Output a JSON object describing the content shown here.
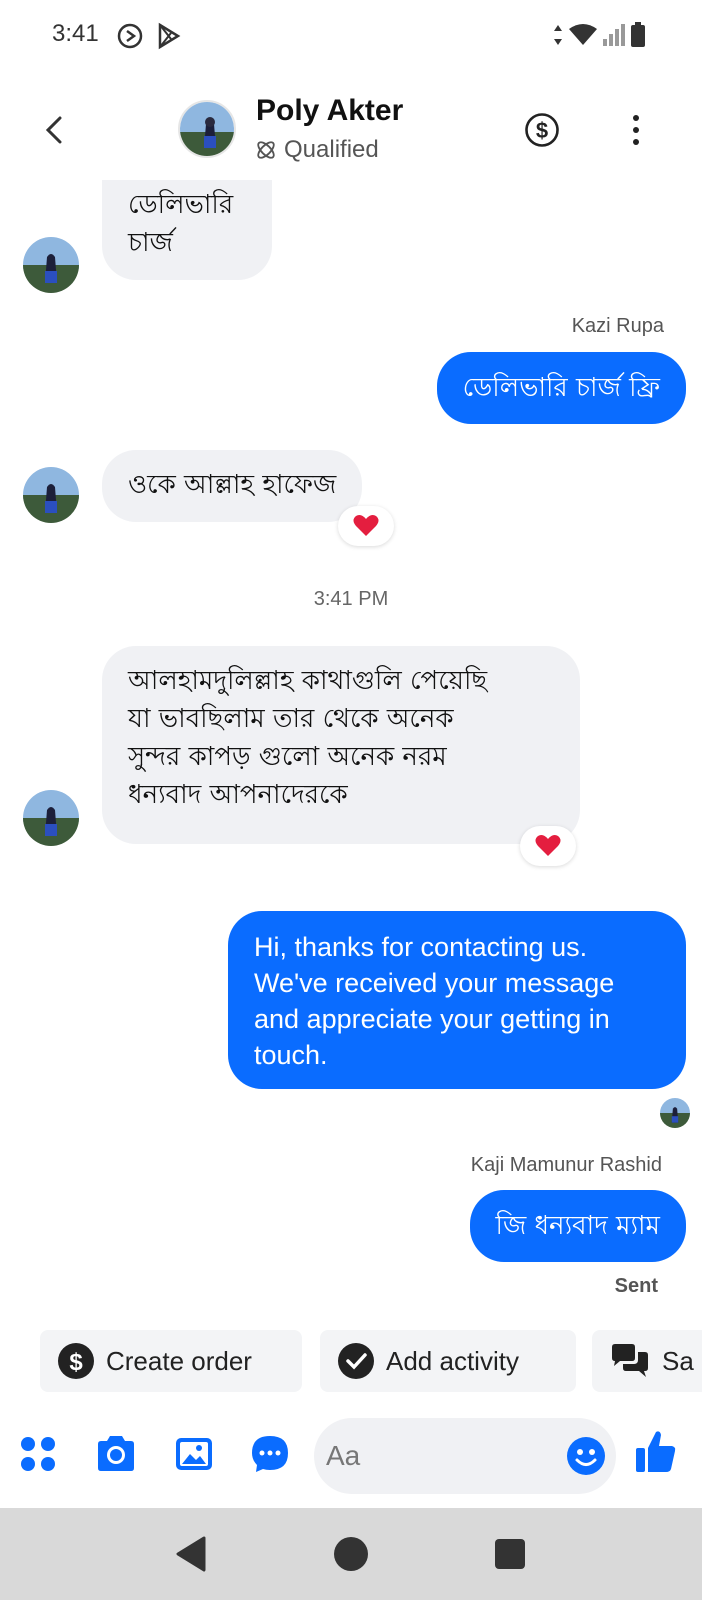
{
  "status_bar": {
    "time": "3:41"
  },
  "header": {
    "name": "Poly Akter",
    "status": "Qualified"
  },
  "messages": [
    {
      "direction": "in",
      "text_lines": [
        "ডেলিভারি",
        "চার্জ"
      ]
    },
    {
      "direction": "out",
      "sender": "Kazi Rupa",
      "text": "ডেলিভারি চার্জ ফ্রি"
    },
    {
      "direction": "in",
      "text": "ওকে আল্লাহ হাফেজ",
      "reaction": "heart"
    },
    {
      "type": "timestamp",
      "text": "3:41 PM"
    },
    {
      "direction": "in",
      "text_lines": [
        "আলহামদুলিল্লাহ কাথাগুলি পেয়েছি",
        "যা ভাবছিলাম তার থেকে অনেক",
        "সুন্দর কাপড়  গুলো অনেক নরম",
        "ধন্যবাদ আপনাদেরকে"
      ],
      "reaction": "heart"
    },
    {
      "direction": "out",
      "text_lines": [
        "Hi, thanks for contacting us.",
        "We've received your message",
        "and appreciate your getting in",
        "touch."
      ]
    },
    {
      "direction": "out",
      "sender": "Kaji Mamunur Rashid",
      "text": "জি ধন্যবাদ ম্যাম",
      "status": "Sent"
    }
  ],
  "quick_actions": [
    {
      "label": "Create order",
      "icon": "dollar-circle-icon"
    },
    {
      "label": "Add activity",
      "icon": "check-circle-icon"
    },
    {
      "label": "Sa",
      "icon": "chat-bubbles-icon"
    }
  ],
  "composer": {
    "placeholder": "Aa"
  },
  "colors": {
    "accent": "#0a6cff",
    "incoming_bubble": "#f0f1f4",
    "reaction": "#e41e3f"
  }
}
